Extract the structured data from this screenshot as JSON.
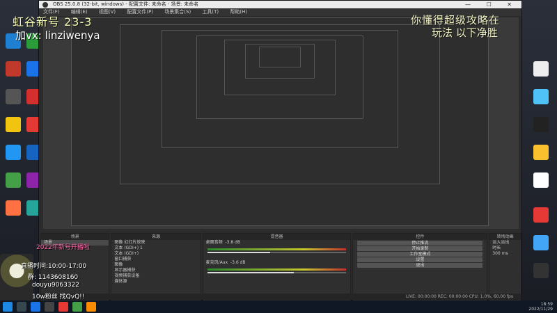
{
  "window": {
    "title": "OBS 25.0.8 (32-bit, windows) - 配置文件: 未命名 - 场景: 未命名",
    "controls": "— ☐ ✕"
  },
  "menu": [
    "文件(F)",
    "编辑(E)",
    "视图(V)",
    "配置文件(P)",
    "场景集合(S)",
    "工具(T)",
    "帮助(H)"
  ],
  "overlay": {
    "title": "虹谷新号 23-3",
    "wechat": "加vx: linziwenya",
    "marquee_1": "你懂得超级攻略在",
    "marquee_2": "玩法 以下净胜"
  },
  "docks": {
    "scenes": {
      "title": "场景",
      "items": [
        "场景"
      ]
    },
    "sources": {
      "title": "来源",
      "items": [
        "图像 幻灯片放映",
        "文本 (GDI+) 1",
        "文本 (GDI+)",
        "窗口捕获",
        "图像",
        "显示器捕获",
        "视频捕获设备",
        "媒体源"
      ]
    },
    "mixer": {
      "title": "混音器",
      "ch1": "桌面音频",
      "ch1_db": "-3.8 dB",
      "ch2": "麦克风/Aux",
      "ch2_db": "-3.6 dB",
      "ch1_level": 0.45,
      "ch2_level": 0.62
    },
    "transitions": {
      "title": "转场动画",
      "current": "淡入淡出",
      "duration_label": "时长",
      "duration": "300 ms"
    },
    "controls": {
      "title": "控件",
      "buttons": [
        "停止推流",
        "开始录制",
        "工作室模式",
        "设置",
        "退出"
      ]
    }
  },
  "status": {
    "text": "LIVE: 00:00:00  REC: 00:00:00  CPU: 1.0%, 60.00 fps"
  },
  "card": {
    "line1": "2022年新号开播啦",
    "line2": "直播时间:10:00-17:00",
    "line3": "群: 1143608160",
    "line4": "douyu9063322",
    "line5": "10w粉丝 找QvQ!!"
  },
  "tray": {
    "time": "18:59",
    "date": "2022/11/29"
  },
  "colors": {
    "accent": "#f4f7b0",
    "pink": "#ff66aa"
  }
}
